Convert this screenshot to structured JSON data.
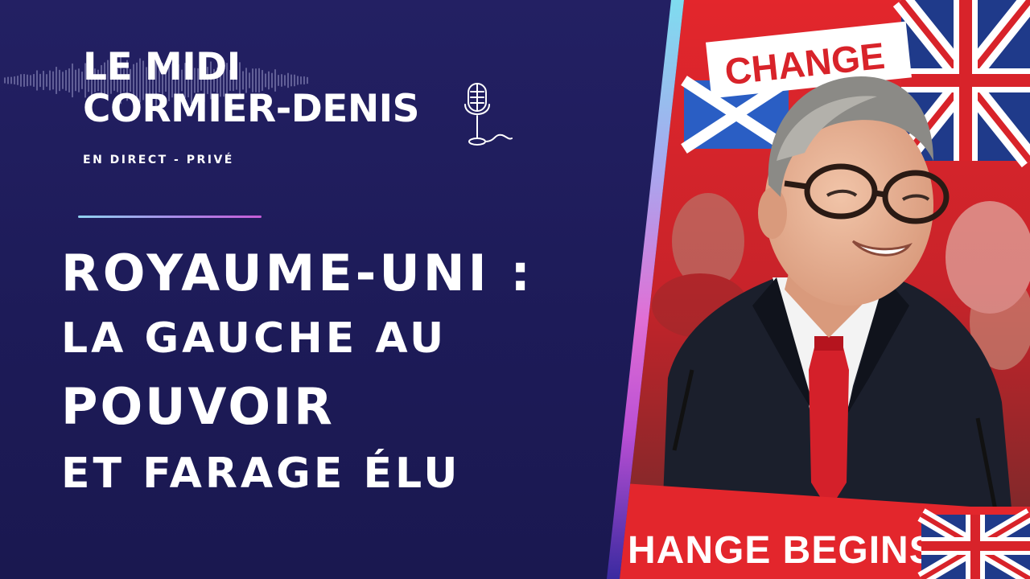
{
  "show": {
    "title_line1": "LE MIDI",
    "title_line2": "CORMIER-DENIS",
    "subtitle": "EN DIRECT - PRIVÉ"
  },
  "headline": {
    "line1": "ROYAUME-UNI :",
    "line2": "LA GAUCHE AU",
    "line3": "POUVOIR",
    "line4": "ET FARAGE ÉLU"
  },
  "photo": {
    "sign_top": "CHANGE",
    "sign_bottom": "HANGE BEGINS"
  },
  "colors": {
    "background": "#1d1b58",
    "text": "#ffffff",
    "accent_stripe_top": "#7fdcef",
    "accent_stripe_bottom": "#b94fd4",
    "photo_red": "#e3262c"
  },
  "icons": [
    "waveform-icon",
    "microphone-icon"
  ]
}
